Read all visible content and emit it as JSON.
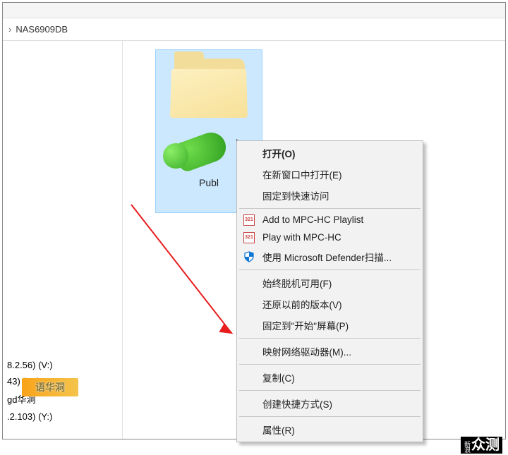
{
  "address": {
    "location": "NAS6909DB"
  },
  "nav": {
    "items": [
      "8.2.56) (V:)",
      "43) (W:)",
      "gd华洞",
      ".2.103) (Y:)"
    ],
    "watermark": "语华洞"
  },
  "content": {
    "folder_label": "Publ"
  },
  "context_menu": {
    "items": [
      {
        "label": "打开(O)",
        "bold": true
      },
      {
        "label": "在新窗口中打开(E)"
      },
      {
        "label": "固定到快速访问"
      },
      {
        "sep": true
      },
      {
        "label": "Add to MPC-HC Playlist",
        "icon": "mpc"
      },
      {
        "label": "Play with MPC-HC",
        "icon": "mpc"
      },
      {
        "label": "使用 Microsoft Defender扫描...",
        "icon": "defender"
      },
      {
        "sep": true
      },
      {
        "label": "始终脱机可用(F)"
      },
      {
        "label": "还原以前的版本(V)"
      },
      {
        "label": "固定到\"开始\"屏幕(P)"
      },
      {
        "sep": true
      },
      {
        "label": "映射网络驱动器(M)..."
      },
      {
        "sep": true
      },
      {
        "label": "复制(C)"
      },
      {
        "sep": true
      },
      {
        "label": "创建快捷方式(S)"
      },
      {
        "sep": true
      },
      {
        "label": "属性(R)"
      }
    ]
  },
  "branding": {
    "small": "新浪",
    "big": "众测"
  }
}
